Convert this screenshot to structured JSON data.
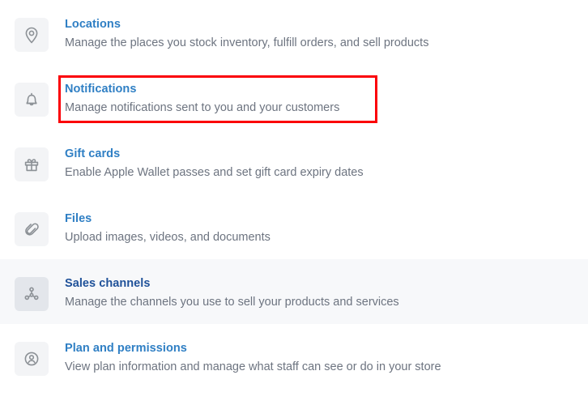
{
  "theme": {
    "link_color": "#2f7fc4",
    "link_color_visited": "#1f5199",
    "description_color": "#6d7480",
    "icon_color": "#8c9196",
    "icon_tile_bg": "#f3f4f6",
    "row_highlight_bg": "#f7f8fa",
    "annotation_color": "#fb0007",
    "page_bg": "#ffffff"
  },
  "annotation": {
    "target": "notifications-row",
    "shape": "rectangle",
    "color": "#fb0007"
  },
  "settings": {
    "rows": [
      {
        "icon": "location-pin-icon",
        "title": "Locations",
        "description": "Manage the places you stock inventory, fulfill orders, and sell products",
        "highlighted": false,
        "visited": false
      },
      {
        "icon": "bell-icon",
        "title": "Notifications",
        "description": "Manage notifications sent to you and your customers",
        "highlighted": false,
        "visited": false
      },
      {
        "icon": "gift-card-icon",
        "title": "Gift cards",
        "description": "Enable Apple Wallet passes and set gift card expiry dates",
        "highlighted": false,
        "visited": false
      },
      {
        "icon": "paperclip-icon",
        "title": "Files",
        "description": "Upload images, videos, and documents",
        "highlighted": false,
        "visited": false
      },
      {
        "icon": "sales-channels-nodes-icon",
        "title": "Sales channels",
        "description": "Manage the channels you use to sell your products and services",
        "highlighted": true,
        "visited": true
      },
      {
        "icon": "account-circle-icon",
        "title": "Plan and permissions",
        "description": "View plan information and manage what staff can see or do in your store",
        "highlighted": false,
        "visited": false
      }
    ]
  }
}
